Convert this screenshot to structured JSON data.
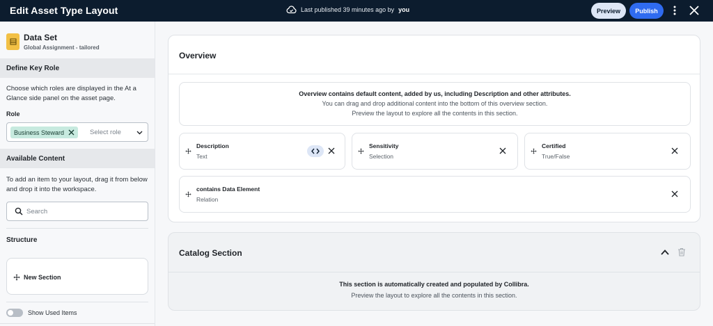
{
  "header": {
    "title": "Edit Asset Type Layout",
    "status_prefix": "Last published 39 minutes ago by",
    "status_user": "you",
    "preview_label": "Preview",
    "publish_label": "Publish",
    "icons": [
      "cloud-check-icon",
      "kebab-menu-icon",
      "close-icon"
    ]
  },
  "sidebar": {
    "asset_title": "Data Set",
    "asset_subtitle": "Global Assignment - tailored",
    "key_role": {
      "heading": "Define Key Role",
      "description": "Choose which roles are displayed in the At a Glance side panel on the asset page.",
      "field_label": "Role",
      "selected_chip": "Business Steward",
      "placeholder": "Select role"
    },
    "available": {
      "heading": "Available Content",
      "description": "To add an item to your layout, drag it from below and drop it into the workspace.",
      "search_placeholder": "Search"
    },
    "structure": {
      "heading": "Structure",
      "item": "New Section"
    },
    "toggle_label": "Show Used Items"
  },
  "overview": {
    "title": "Overview",
    "info_line1": "Overview contains default content, added by us, including Description and other attributes.",
    "info_line2": "You can drag and drop additional content into the bottom of this overview section.",
    "info_line3": "Preview the layout to explore all the contents in this section.",
    "cards": [
      {
        "title": "Description",
        "type": "Text"
      },
      {
        "title": "Sensitivity",
        "type": "Selection"
      },
      {
        "title": "Certified",
        "type": "True/False"
      },
      {
        "title": "contains Data Element",
        "type": "Relation"
      }
    ]
  },
  "catalog": {
    "title": "Catalog Section",
    "line1": "This section is automatically created and populated by Collibra.",
    "line2": "Preview the layout to explore all the contents in this section."
  },
  "colors": {
    "topbar": "#0c1c2e",
    "publish": "#2f6bf0",
    "chip": "#c7eadf",
    "asset_icon": "#f2c045"
  }
}
